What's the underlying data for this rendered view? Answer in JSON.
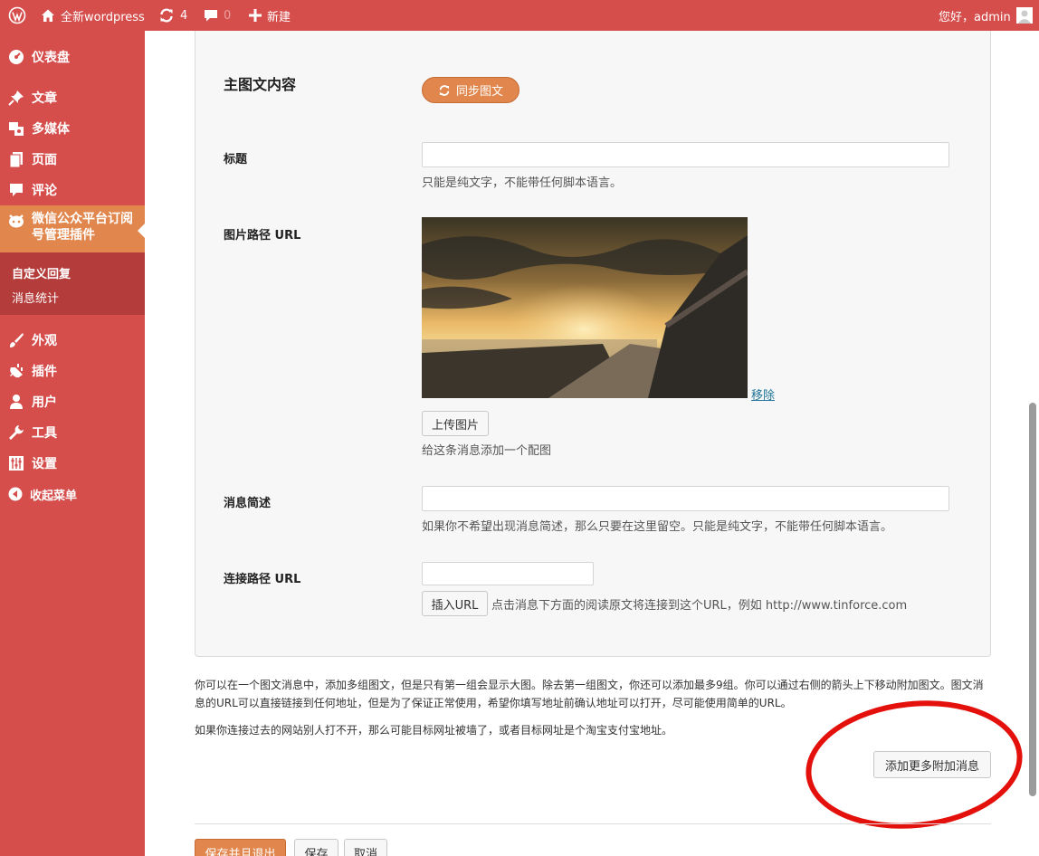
{
  "adminbar": {
    "site_name": "全新wordpress",
    "updates_count": "4",
    "comments_count": "0",
    "new_label": "新建",
    "greeting": "您好，admin"
  },
  "sidebar": {
    "items": [
      {
        "label": "仪表盘",
        "icon": "dashboard-icon"
      },
      {
        "label": "文章",
        "icon": "pin-icon"
      },
      {
        "label": "多媒体",
        "icon": "media-icon"
      },
      {
        "label": "页面",
        "icon": "page-icon"
      },
      {
        "label": "评论",
        "icon": "comment-icon"
      },
      {
        "label": "微信公众平台订阅号管理插件",
        "icon": "plugin-logo-icon"
      },
      {
        "label": "外观",
        "icon": "brush-icon"
      },
      {
        "label": "插件",
        "icon": "plug-icon"
      },
      {
        "label": "用户",
        "icon": "user-icon"
      },
      {
        "label": "工具",
        "icon": "wrench-icon"
      },
      {
        "label": "设置",
        "icon": "settings-icon"
      },
      {
        "label": "收起菜单",
        "icon": "collapse-icon"
      }
    ],
    "submenu": [
      {
        "label": "自定义回复"
      },
      {
        "label": "消息统计"
      }
    ]
  },
  "form": {
    "section_title": "主图文内容",
    "sync_button": "同步图文",
    "title_label": "标题",
    "title_value": "",
    "title_desc": "只能是纯文字，不能带任何脚本语言。",
    "image_label": "图片路径 URL",
    "remove_link": "移除",
    "upload_button": "上传图片",
    "image_desc": "给这条消息添加一个配图",
    "summary_label": "消息简述",
    "summary_value": "",
    "summary_desc": "如果你不希望出现消息简述，那么只要在这里留空。只能是纯文字，不能带任何脚本语言。",
    "url_label": "连接路径 URL",
    "url_value": "",
    "insert_url_button": "插入URL",
    "url_desc": "点击消息下方面的阅读原文将连接到这个URL，例如 http://www.tinforce.com"
  },
  "notes": {
    "para1": "你可以在一个图文消息中，添加多组图文，但是只有第一组会显示大图。除去第一组图文，你还可以添加最多9组。你可以通过右侧的箭头上下移动附加图文。图文消息的URL可以直接链接到任何地址，但是为了保证正常使用，希望你填写地址前确认地址可以打开，尽可能使用简单的URL。",
    "para2": "如果你连接过去的网站别人打不开，那么可能目标网址被墙了，或者目标网址是个淘宝支付宝地址。",
    "add_more_button": "添加更多附加消息"
  },
  "footer": {
    "save_exit": "保存并且退出",
    "save": "保存",
    "cancel": "取消"
  },
  "colors": {
    "admin_red": "#d54e4c",
    "accent_orange": "#e1874d",
    "submenu_dark": "#b43d3b",
    "annotation_red": "#e3100c"
  }
}
